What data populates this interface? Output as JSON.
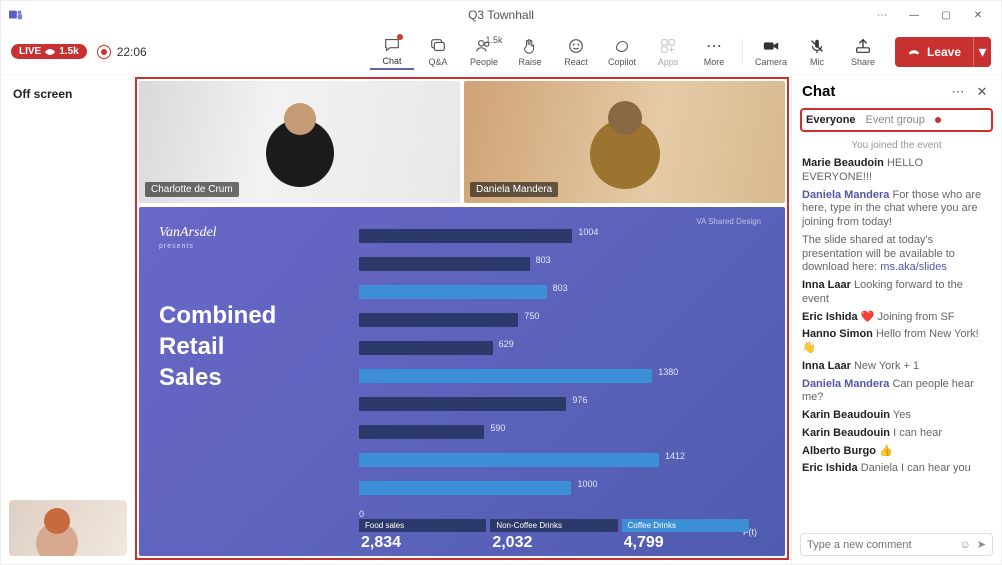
{
  "window": {
    "title": "Q3 Townhall"
  },
  "status": {
    "live_label": "LIVE",
    "viewers": "1.5k",
    "timer": "22:06"
  },
  "toolbar": {
    "items": [
      {
        "label": "Chat",
        "name": "chat"
      },
      {
        "label": "Q&A",
        "name": "qa"
      },
      {
        "label": "People",
        "name": "people",
        "count": "1.5k"
      },
      {
        "label": "Raise",
        "name": "raise"
      },
      {
        "label": "React",
        "name": "react"
      },
      {
        "label": "Copilot",
        "name": "copilot"
      },
      {
        "label": "Apps",
        "name": "apps"
      },
      {
        "label": "More",
        "name": "more"
      }
    ],
    "right": [
      {
        "label": "Camera",
        "name": "camera"
      },
      {
        "label": "Mic",
        "name": "mic"
      },
      {
        "label": "Share",
        "name": "share"
      }
    ],
    "leave": "Leave"
  },
  "left": {
    "off_screen": "Off screen"
  },
  "participants": [
    {
      "name": "Charlotte de Crum"
    },
    {
      "name": "Daniela Mandera"
    }
  ],
  "slide": {
    "brand": "VanArsdel",
    "brand_sub": "presents",
    "title_l1": "Combined",
    "title_l2": "Retail",
    "title_l3": "Sales",
    "tag": "VA Shared Design"
  },
  "chart_data": {
    "type": "bar",
    "orientation": "horizontal",
    "series_kinds": [
      "dark",
      "light"
    ],
    "rows": [
      {
        "kind": "dark",
        "value": 1004,
        "label_side": "right"
      },
      {
        "kind": "dark",
        "value": 803,
        "label_side": "right"
      },
      {
        "kind": "light",
        "value": 803,
        "label_side": "right",
        "long": true
      },
      {
        "kind": "dark",
        "value": 750,
        "label_side": "right"
      },
      {
        "kind": "dark",
        "value": 629,
        "label_side": "right"
      },
      {
        "kind": "light",
        "value": 1380,
        "label_side": "right"
      },
      {
        "kind": "dark",
        "value": 976,
        "label_side": "right"
      },
      {
        "kind": "dark",
        "value": 590,
        "label_side": "right"
      },
      {
        "kind": "light",
        "value": 1412,
        "label_side": "right"
      },
      {
        "kind": "light",
        "value": 1000,
        "label_side": "right"
      }
    ],
    "totals": [
      {
        "label": "Food sales",
        "value": "2,834",
        "kind": "dark"
      },
      {
        "label": "Non-Coffee Drinks",
        "value": "2,032",
        "kind": "dark"
      },
      {
        "label": "Coffee Drinks",
        "value": "4,799",
        "kind": "light"
      }
    ],
    "axis_marks": [
      "0",
      "F(t)"
    ]
  },
  "chat": {
    "title": "Chat",
    "tabs": {
      "everyone": "Everyone",
      "event_group": "Event group"
    },
    "system": "You joined the event",
    "messages": [
      {
        "who": "Marie Beaudoin",
        "body": "HELLO EVERYONE!!!"
      },
      {
        "who": "Daniela Mandera",
        "who_link": true,
        "body": "For those who are here, type in the chat where you are joining from today!"
      },
      {
        "body_pre": "The slide shared at today's presentation will be available to download here: ",
        "link": "ms.aka/slides"
      },
      {
        "who": "Inna Laar",
        "body": "Looking forward to the event"
      },
      {
        "who": "Eric Ishida",
        "emoji": "❤️",
        "body": "Joining from SF"
      },
      {
        "who": "Hanno Simon",
        "body": "Hello from New York!",
        "emoji_after": "👋"
      },
      {
        "who": "Inna Laar",
        "body": "New York + 1"
      },
      {
        "who": "Daniela Mandera",
        "who_link": true,
        "body": "Can people hear me?"
      },
      {
        "who": "Karin Beaudouin",
        "body": "Yes"
      },
      {
        "who": "Karin Beaudouin",
        "body": "I can hear"
      },
      {
        "who": "Alberto Burgo",
        "emoji": "👍",
        "body": ""
      },
      {
        "who": "Eric Ishida",
        "body": "Daniela I can hear you"
      }
    ],
    "input_placeholder": "Type a new comment"
  }
}
